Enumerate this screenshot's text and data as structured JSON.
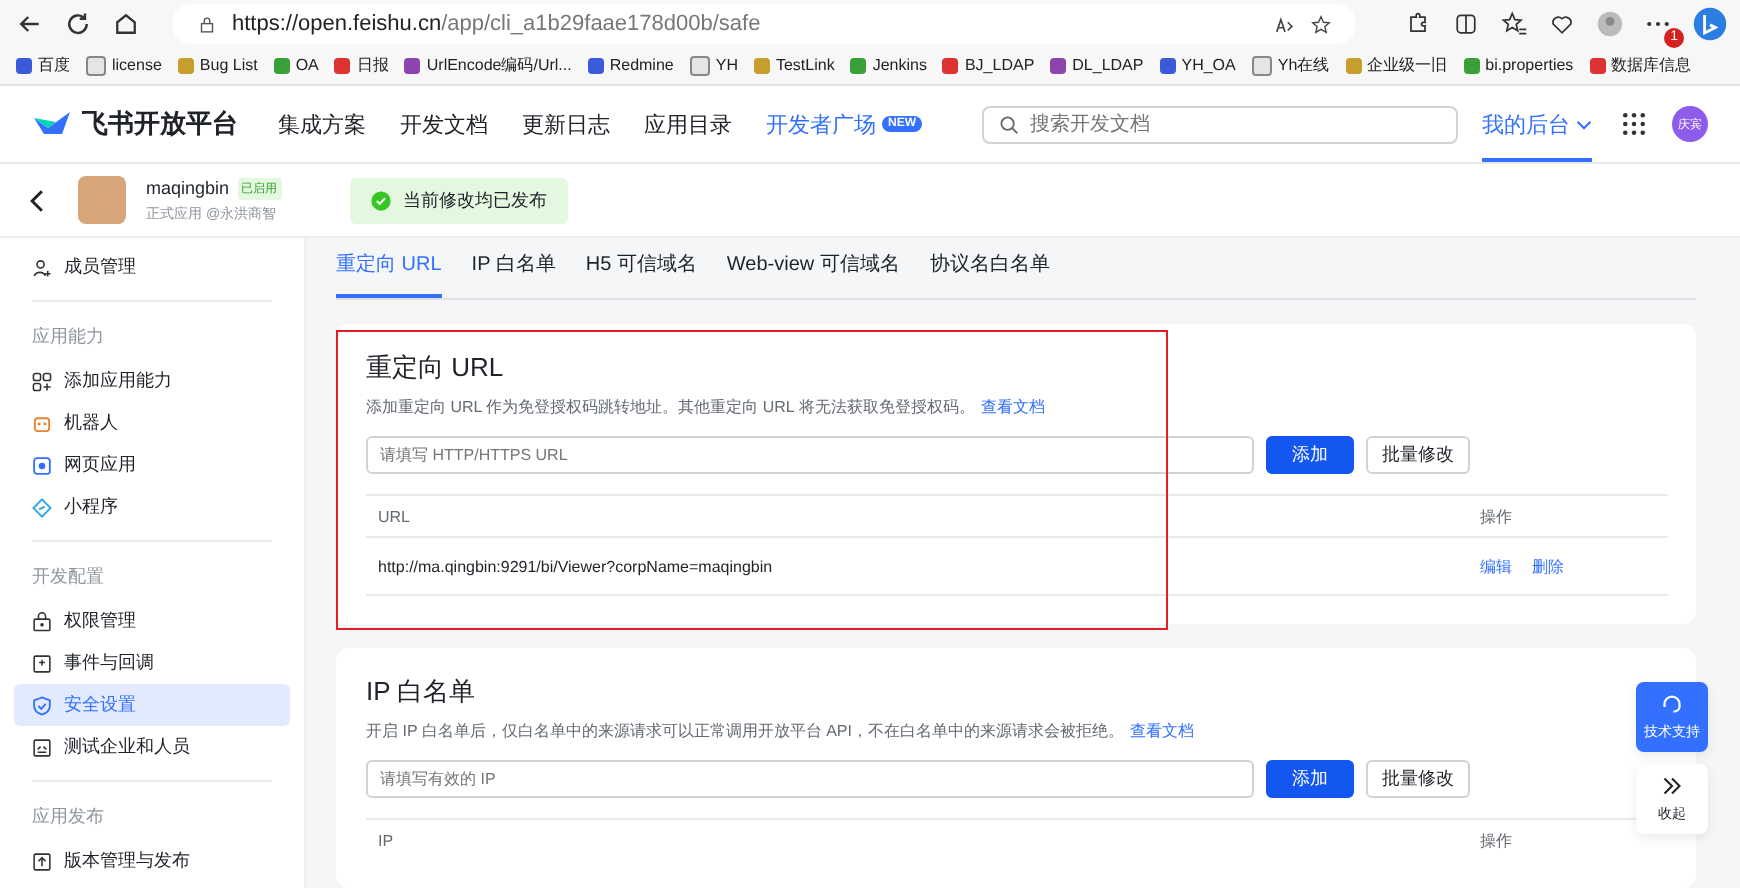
{
  "browser": {
    "url_host": "https://open.feishu.cn",
    "url_path": "/app/cli_a1b29faae178d00b/safe",
    "notification_count": "1",
    "bookmarks": [
      "百度",
      "license",
      "Bug List",
      "OA",
      "日报",
      "UrlEncode编码/Url...",
      "Redmine",
      "YH",
      "TestLink",
      "Jenkins",
      "BJ_LDAP",
      "DL_LDAP",
      "YH_OA",
      "Yh在线",
      "企业级一旧",
      "bi.properties",
      "数据库信息"
    ]
  },
  "header": {
    "logo": "飞书开放平台",
    "nav": [
      {
        "label": "集成方案",
        "highlighted": false
      },
      {
        "label": "开发文档",
        "highlighted": false
      },
      {
        "label": "更新日志",
        "highlighted": false
      },
      {
        "label": "应用目录",
        "highlighted": false
      },
      {
        "label": "开发者广场",
        "highlighted": true,
        "badge": "NEW"
      }
    ],
    "search": {
      "placeholder": "搜索开发文档"
    },
    "my_console": {
      "label": "我的后台",
      "selected": true
    },
    "avatar": "庆宾"
  },
  "app": {
    "name": "maqingbin",
    "status": "已启用",
    "subtitle": "正式应用 @永洪商智",
    "toast": "当前修改均已发布"
  },
  "sidebar": {
    "sections": [
      {
        "items": [
          {
            "label": "成员管理",
            "selected": false
          }
        ]
      },
      {
        "title": "应用能力",
        "items": [
          {
            "label": "添加应用能力",
            "selected": false
          },
          {
            "label": "机器人",
            "selected": false
          },
          {
            "label": "网页应用",
            "selected": false
          },
          {
            "label": "小程序",
            "selected": false
          }
        ]
      },
      {
        "title": "开发配置",
        "items": [
          {
            "label": "权限管理",
            "selected": false
          },
          {
            "label": "事件与回调",
            "selected": false
          },
          {
            "label": "安全设置",
            "selected": true
          },
          {
            "label": "测试企业和人员",
            "selected": false
          }
        ]
      },
      {
        "title": "应用发布",
        "items": [
          {
            "label": "版本管理与发布",
            "selected": false
          }
        ]
      }
    ]
  },
  "tabs": [
    {
      "label": "重定向 URL",
      "selected": true
    },
    {
      "label": "IP 白名单",
      "selected": false
    },
    {
      "label": "H5 可信域名",
      "selected": false
    },
    {
      "label": "Web-view 可信域名",
      "selected": false
    },
    {
      "label": "协议名白名单",
      "selected": false
    }
  ],
  "cards": [
    {
      "title": "重定向 URL",
      "description": "添加重定向 URL 作为免登授权码跳转地址。其他重定向 URL 将无法获取免登授权码。",
      "doc_link": "查看文档",
      "placeholder": "请填写 HTTP/HTTPS URL",
      "add_button": "添加",
      "batch_button": "批量修改",
      "highlighted": true,
      "columns": [
        "URL",
        "操作"
      ],
      "rows": [
        {
          "value": "http://ma.qingbin:9291/bi/Viewer?corpName=maqingbin",
          "actions": [
            "编辑",
            "删除"
          ]
        }
      ]
    },
    {
      "title": "IP 白名单",
      "description": "开启 IP 白名单后，仅白名单中的来源请求可以正常调用开放平台 API，不在白名单中的来源请求会被拒绝。",
      "doc_link": "查看文档",
      "placeholder": "请填写有效的 IP",
      "add_button": "添加",
      "batch_button": "批量修改",
      "highlighted": false,
      "columns": [
        "IP",
        "操作"
      ]
    }
  ],
  "floating": [
    {
      "kind": "support",
      "label": "技术支持"
    },
    {
      "kind": "collapse",
      "label": "收起"
    }
  ]
}
